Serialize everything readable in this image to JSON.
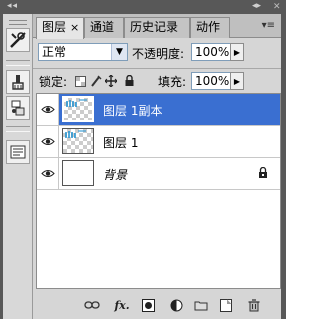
{
  "topbar": {
    "collapse_left": "◂◂",
    "collapse_right": "◂▸"
  },
  "dock": {
    "items": [
      "tools-icon",
      "brush-icon",
      "clone-source-icon",
      "notes-icon"
    ]
  },
  "tabs": [
    {
      "label": "图层",
      "close": "×",
      "active": true
    },
    {
      "label": "通道",
      "active": false
    },
    {
      "label": "历史记录",
      "active": false
    },
    {
      "label": "动作",
      "active": false
    }
  ],
  "panel_menu": "▾≡",
  "blend": {
    "mode": "正常",
    "opacity_label": "不透明度:",
    "opacity_value": "100%"
  },
  "lock": {
    "label": "锁定:",
    "fill_label": "填充:",
    "fill_value": "100%"
  },
  "layers": [
    {
      "name": "图层 1副本",
      "selected": true,
      "visible": true,
      "thumb": "checker"
    },
    {
      "name": "图层 1",
      "selected": false,
      "visible": true,
      "thumb": "checker"
    },
    {
      "name": "背景",
      "selected": false,
      "visible": true,
      "thumb": "white",
      "locked": true,
      "italic": true
    }
  ],
  "footer": {
    "fx_label": "fx."
  },
  "colors": {
    "selection": "#3a6fd1",
    "panel": "#d6d6d6",
    "dark": "#585858"
  }
}
